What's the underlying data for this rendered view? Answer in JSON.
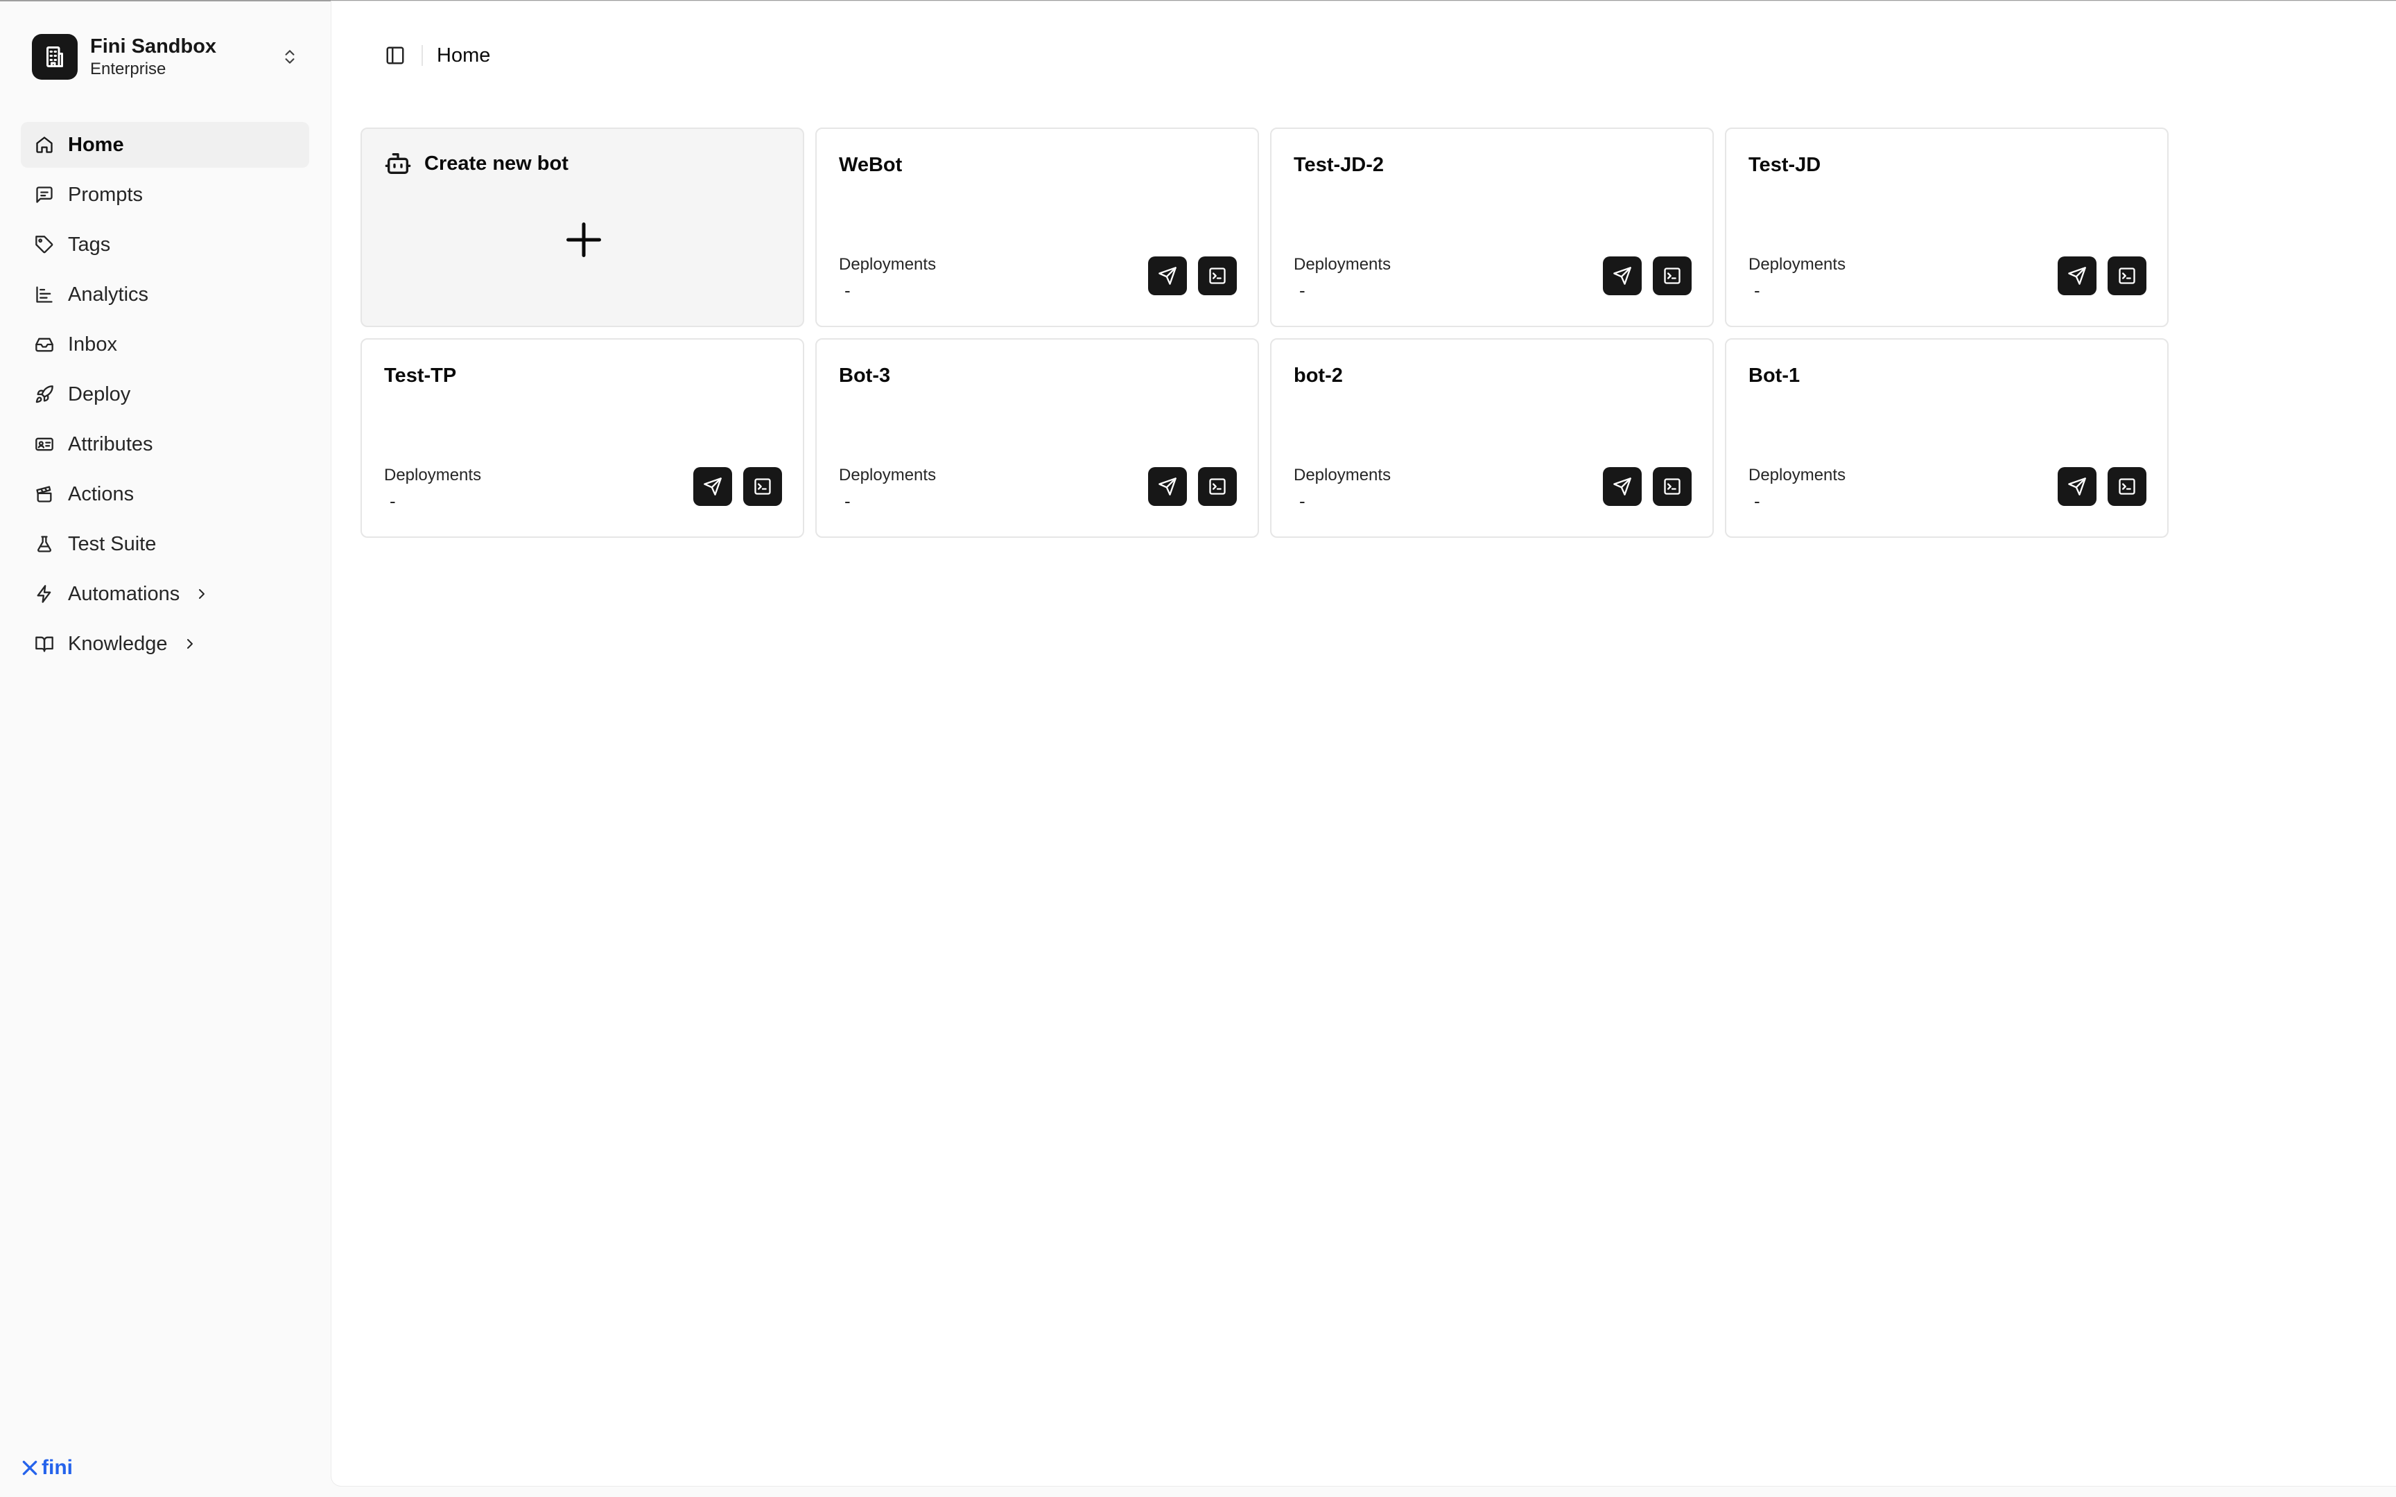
{
  "org": {
    "name": "Fini Sandbox",
    "plan": "Enterprise"
  },
  "sidebar": {
    "items": [
      {
        "label": "Home",
        "icon": "home-icon",
        "active": true
      },
      {
        "label": "Prompts",
        "icon": "message-square-icon"
      },
      {
        "label": "Tags",
        "icon": "tag-icon"
      },
      {
        "label": "Analytics",
        "icon": "bar-chart-icon"
      },
      {
        "label": "Inbox",
        "icon": "inbox-icon"
      },
      {
        "label": "Deploy",
        "icon": "rocket-icon"
      },
      {
        "label": "Attributes",
        "icon": "id-card-icon"
      },
      {
        "label": "Actions",
        "icon": "clapperboard-icon"
      },
      {
        "label": "Test Suite",
        "icon": "flask-icon"
      },
      {
        "label": "Automations",
        "icon": "zap-icon",
        "expandable": true
      },
      {
        "label": "Knowledge",
        "icon": "book-open-icon",
        "expandable": true
      }
    ]
  },
  "brand": {
    "name": "fini",
    "color": "#2563eb"
  },
  "header": {
    "breadcrumb": "Home"
  },
  "create_card": {
    "label": "Create new bot",
    "icon": "bot-icon"
  },
  "bots": [
    {
      "name": "WeBot",
      "deployments_label": "Deployments",
      "deployments_value": "-"
    },
    {
      "name": "Test-JD-2",
      "deployments_label": "Deployments",
      "deployments_value": "-"
    },
    {
      "name": "Test-JD",
      "deployments_label": "Deployments",
      "deployments_value": "-"
    },
    {
      "name": "Test-TP",
      "deployments_label": "Deployments",
      "deployments_value": "-"
    },
    {
      "name": "Bot-3",
      "deployments_label": "Deployments",
      "deployments_value": "-"
    },
    {
      "name": "bot-2",
      "deployments_label": "Deployments",
      "deployments_value": "-"
    },
    {
      "name": "Bot-1",
      "deployments_label": "Deployments",
      "deployments_value": "-"
    }
  ],
  "bot_actions": [
    "send-icon",
    "terminal-icon"
  ]
}
